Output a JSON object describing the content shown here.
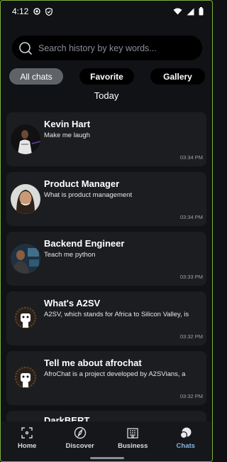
{
  "status_bar": {
    "time": "4:12",
    "icons": [
      "recording-icon",
      "shield-icon",
      "wifi-icon",
      "signal-icon",
      "battery-icon"
    ]
  },
  "search": {
    "placeholder": "Search history by key words...",
    "icon": "search-icon"
  },
  "filters": {
    "tabs": [
      {
        "label": "All chats",
        "active": true
      },
      {
        "label": "Favorite",
        "active": false
      },
      {
        "label": "Gallery",
        "active": false
      }
    ]
  },
  "section": {
    "date": "Today"
  },
  "chats": [
    {
      "title": "Kevin Hart",
      "preview": "Make me laugh",
      "time": "03:34 PM",
      "avatar": "kevin-hart-avatar"
    },
    {
      "title": "Product Manager",
      "preview": "What is product management",
      "time": "03:34 PM",
      "avatar": "product-manager-avatar"
    },
    {
      "title": "Backend Engineer",
      "preview": "Teach me python",
      "time": "03:33 PM",
      "avatar": "backend-engineer-avatar"
    },
    {
      "title": "What's A2SV",
      "preview": "A2SV, which stands for Africa to Silicon Valley, is",
      "time": "03:32 PM",
      "avatar": "afrochat-bot-avatar"
    },
    {
      "title": "Tell me about afrochat",
      "preview": "AfroChat is a project developed by A2SVians, a",
      "time": "03:32 PM",
      "avatar": "afrochat-bot-avatar"
    },
    {
      "title": "DarkBERT",
      "preview": "",
      "time": "",
      "avatar": "afrochat-bot-avatar"
    }
  ],
  "bottom_nav": {
    "items": [
      {
        "label": "Home",
        "icon": "home-icon",
        "active": false
      },
      {
        "label": "Discover",
        "icon": "compass-icon",
        "active": false
      },
      {
        "label": "Business",
        "icon": "building-icon",
        "active": false
      },
      {
        "label": "Chats",
        "icon": "chats-icon",
        "active": true
      }
    ]
  },
  "colors": {
    "background": "#101216",
    "card": "#1b1d21",
    "active_tab": "#5f6367",
    "active_nav": "#8ab4e0",
    "frame_border": "#7fb03a"
  }
}
